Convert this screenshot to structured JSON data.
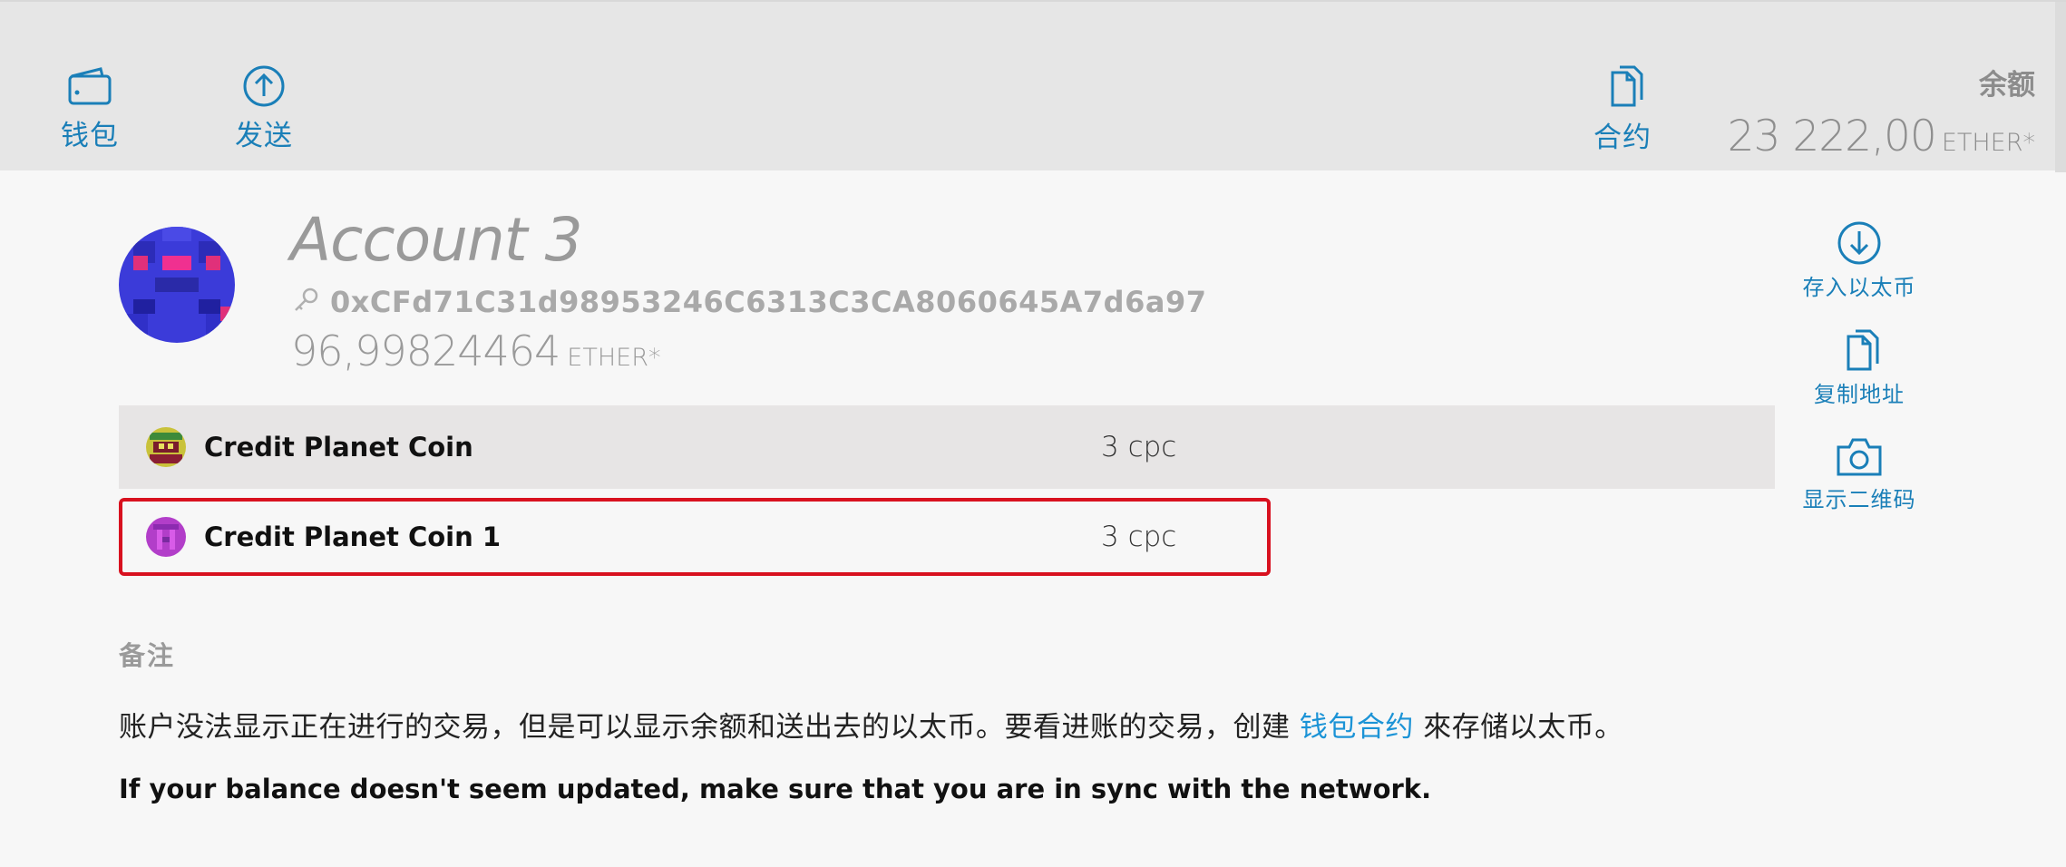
{
  "nav": {
    "wallet_label": "钱包",
    "send_label": "发送",
    "contract_label": "合约"
  },
  "balance": {
    "title": "余额",
    "value": "23 222,00",
    "unit": "ETHER*"
  },
  "account": {
    "name": "Account 3",
    "address": "0xCFd71C31d98953246C6313C3CA8060645A7d6a97",
    "balance_value": "96,99824464",
    "balance_unit": "ETHER*"
  },
  "tokens": [
    {
      "name": "Credit Planet Coin",
      "qty": "3 cpc"
    },
    {
      "name": "Credit Planet Coin 1",
      "qty": "3 cpc"
    }
  ],
  "side_actions": {
    "deposit_label": "存入以太币",
    "copy_label": "复制地址",
    "qr_label": "显示二维码"
  },
  "notes": {
    "title": "备注",
    "text_before": "账户没法显示正在进行的交易，但是可以显示余额和送出去的以太币。要看进账的交易，创建 ",
    "link": "钱包合约",
    "text_after": " 來存储以太币。",
    "sync": "If your balance doesn't seem updated, make sure that you are in sync with the network."
  },
  "colors": {
    "accent": "#1a7fb8",
    "link": "#1b93d6",
    "highlight_border": "#d8111f"
  }
}
